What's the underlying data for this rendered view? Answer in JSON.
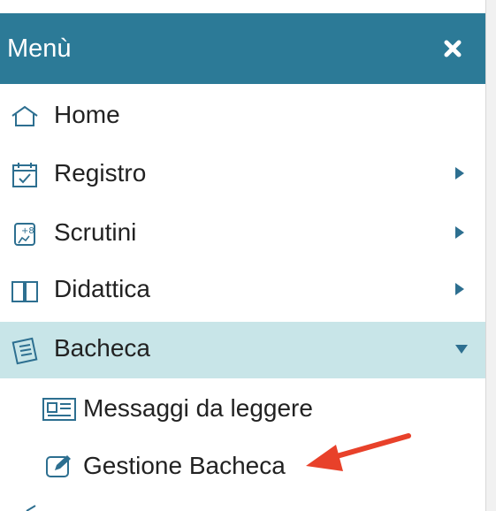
{
  "menu": {
    "title": "Menù",
    "items": [
      {
        "label": "Home",
        "icon": "home-icon"
      },
      {
        "label": "Registro",
        "icon": "calendar-check-icon",
        "expandable": true,
        "expanded": false
      },
      {
        "label": "Scrutini",
        "icon": "scrutini-icon",
        "expandable": true,
        "expanded": false
      },
      {
        "label": "Didattica",
        "icon": "book-icon",
        "expandable": true,
        "expanded": false
      },
      {
        "label": "Bacheca",
        "icon": "board-icon",
        "expandable": true,
        "expanded": true,
        "subitems": [
          {
            "label": "Messaggi da leggere",
            "icon": "newspaper-icon"
          },
          {
            "label": "Gestione Bacheca",
            "icon": "edit-icon"
          }
        ]
      }
    ]
  },
  "colors": {
    "header_bg": "#2c7a97",
    "active_bg": "#c8e5e8",
    "caret": "#2d6f90",
    "annotation_arrow": "#e8412a"
  }
}
